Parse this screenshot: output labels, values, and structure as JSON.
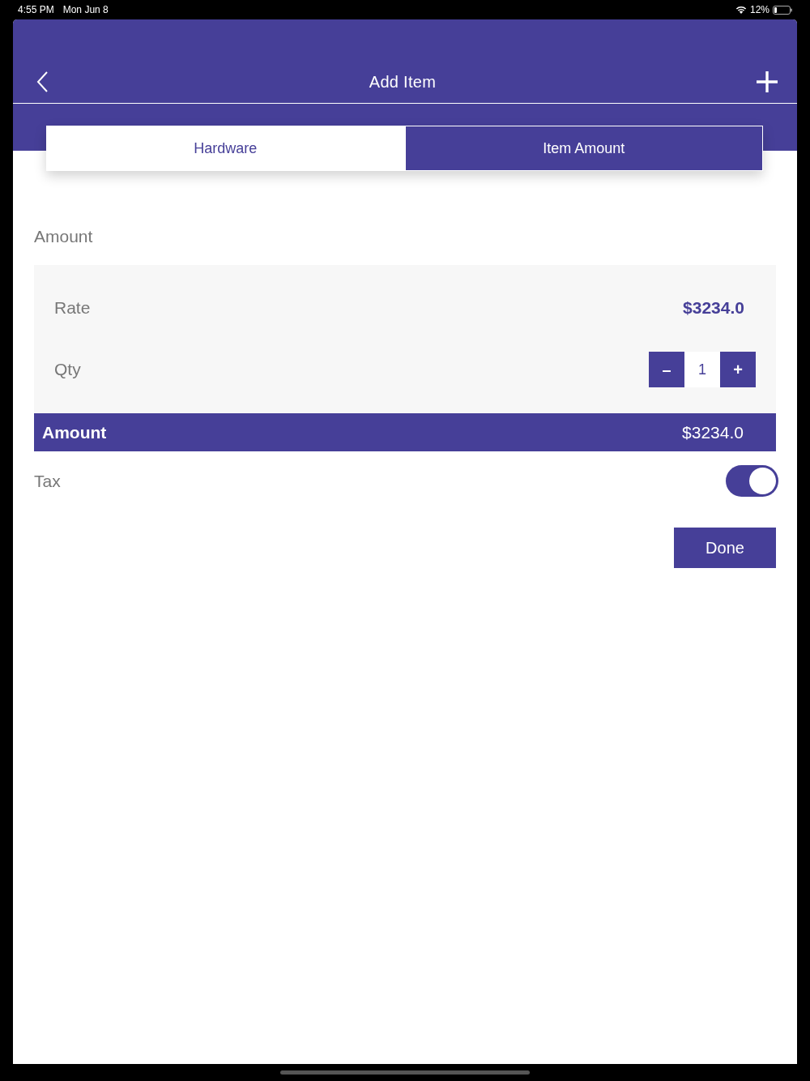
{
  "status_bar": {
    "time": "4:55 PM",
    "date": "Mon Jun 8",
    "battery": "12%"
  },
  "nav": {
    "title": "Add Item"
  },
  "tabs": [
    {
      "label": "Hardware",
      "selected": false
    },
    {
      "label": "Item Amount",
      "selected": true
    }
  ],
  "section": {
    "title": "Amount"
  },
  "rate": {
    "label": "Rate",
    "value": "$3234.0"
  },
  "qty": {
    "label": "Qty",
    "value": "1",
    "minus": "–",
    "plus": "+"
  },
  "total": {
    "label": "Amount",
    "value": "$3234.0"
  },
  "tax": {
    "label": "Tax",
    "on": true
  },
  "done": {
    "label": "Done"
  }
}
